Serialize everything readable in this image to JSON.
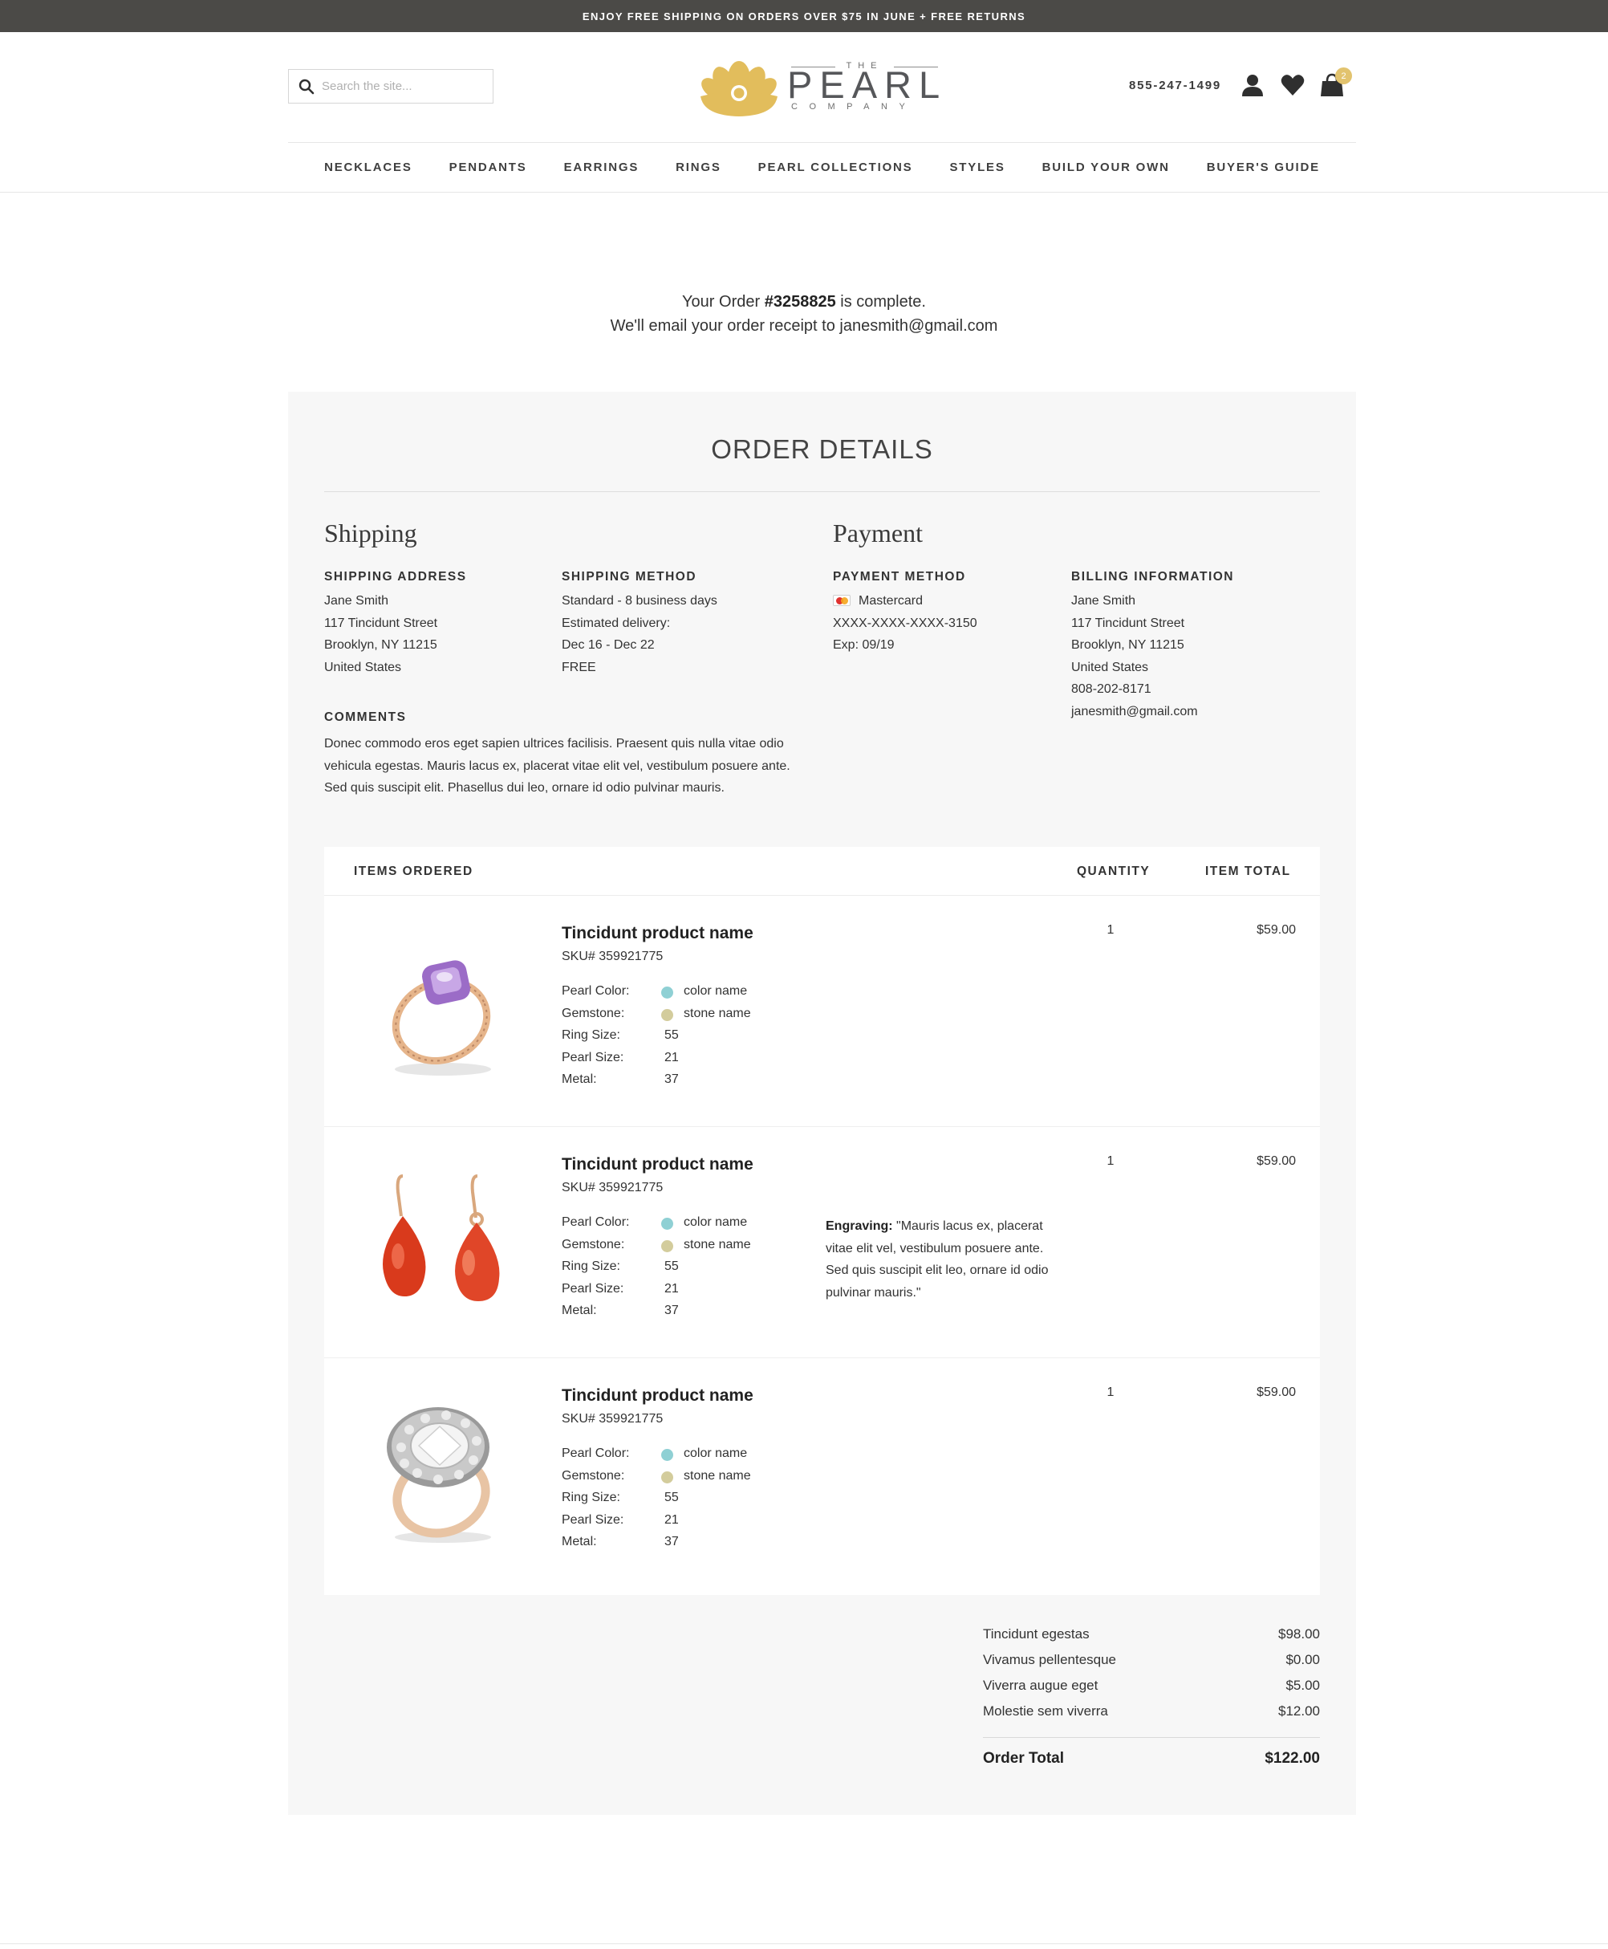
{
  "promo": "ENJOY FREE SHIPPING ON ORDERS OVER $75 IN JUNE + FREE RETURNS",
  "header": {
    "search_placeholder": "Search the site...",
    "logo": {
      "the": "THE",
      "main": "PEARL",
      "sub": "COMPANY"
    },
    "phone": "855-247-1499",
    "cart_count": "2",
    "brand_gold": "#e2bd5c"
  },
  "nav": [
    "NECKLACES",
    "PENDANTS",
    "EARRINGS",
    "RINGS",
    "PEARL COLLECTIONS",
    "STYLES",
    "BUILD YOUR OWN",
    "BUYER'S GUIDE"
  ],
  "confirmation": {
    "prefix": "Your Order ",
    "order_number": "#3258825",
    "suffix": " is complete.",
    "line2": "We'll email your order receipt to janesmith@gmail.com"
  },
  "order_details": {
    "title": "ORDER DETAILS",
    "shipping": {
      "title": "Shipping",
      "address_label": "SHIPPING ADDRESS",
      "address": [
        "Jane Smith",
        "117 Tincidunt Street",
        "Brooklyn, NY 11215",
        "United States"
      ],
      "method_label": "SHIPPING METHOD",
      "method": [
        "Standard - 8 business days",
        "Estimated delivery:",
        "Dec 16 - Dec 22",
        "FREE"
      ],
      "comments_label": "COMMENTS",
      "comments": "Donec commodo eros eget sapien ultrices facilisis. Praesent quis nulla vitae odio vehicula egestas. Mauris lacus ex, placerat vitae elit vel, vestibulum posuere ante. Sed quis suscipit elit. Phasellus dui leo, ornare id odio pulvinar mauris."
    },
    "payment": {
      "title": "Payment",
      "method_label": "PAYMENT METHOD",
      "card_brand": "Mastercard",
      "card_number": "XXXX-XXXX-XXXX-3150",
      "expiry": "Exp: 09/19",
      "billing_label": "BILLING INFORMATION",
      "billing": [
        "Jane Smith",
        "117 Tincidunt Street",
        "Brooklyn, NY 11215",
        "United States",
        "808-202-8171",
        "janesmith@gmail.com"
      ]
    }
  },
  "items_header": {
    "items": "ITEMS ORDERED",
    "quantity": "QUANTITY",
    "total": "ITEM TOTAL"
  },
  "items": [
    {
      "name": "Tincidunt product name",
      "sku": "SKU# 359921775",
      "image": "amethyst-ring-icon",
      "attrs": [
        {
          "k": "Pearl Color:",
          "v": "color name",
          "dot": "#8fd0d4"
        },
        {
          "k": "Gemstone:",
          "v": "stone name",
          "dot": "#d3cc9c"
        },
        {
          "k": "Ring Size:",
          "v": "55"
        },
        {
          "k": "Pearl Size:",
          "v": "21"
        },
        {
          "k": "Metal:",
          "v": "37"
        }
      ],
      "qty": "1",
      "price": "$59.00"
    },
    {
      "name": "Tincidunt product name",
      "sku": "SKU# 359921775",
      "image": "red-drop-earrings-icon",
      "attrs": [
        {
          "k": "Pearl Color:",
          "v": "color name",
          "dot": "#8fd0d4"
        },
        {
          "k": "Gemstone:",
          "v": "stone name",
          "dot": "#d3cc9c"
        },
        {
          "k": "Ring Size:",
          "v": "55"
        },
        {
          "k": "Pearl Size:",
          "v": "21"
        },
        {
          "k": "Metal:",
          "v": "37"
        }
      ],
      "engraving_label": "Engraving:",
      "engraving": " \"Mauris lacus ex, placerat vitae elit vel, vestibulum posuere ante. Sed quis suscipit elit leo, ornare id odio pulvinar mauris.\"",
      "qty": "1",
      "price": "$59.00"
    },
    {
      "name": "Tincidunt product name",
      "sku": "SKU# 359921775",
      "image": "diamond-halo-ring-icon",
      "attrs": [
        {
          "k": "Pearl Color:",
          "v": "color name",
          "dot": "#8fd0d4"
        },
        {
          "k": "Gemstone:",
          "v": "stone name",
          "dot": "#d3cc9c"
        },
        {
          "k": "Ring Size:",
          "v": "55"
        },
        {
          "k": "Pearl Size:",
          "v": "21"
        },
        {
          "k": "Metal:",
          "v": "37"
        }
      ],
      "qty": "1",
      "price": "$59.00"
    }
  ],
  "totals": {
    "rows": [
      {
        "label": "Tincidunt egestas",
        "value": "$98.00"
      },
      {
        "label": "Vivamus pellentesque",
        "value": "$0.00"
      },
      {
        "label": "Viverra augue eget",
        "value": "$5.00"
      },
      {
        "label": "Molestie sem viverra",
        "value": "$12.00"
      }
    ],
    "total_label": "Order Total",
    "total_value": "$122.00"
  }
}
